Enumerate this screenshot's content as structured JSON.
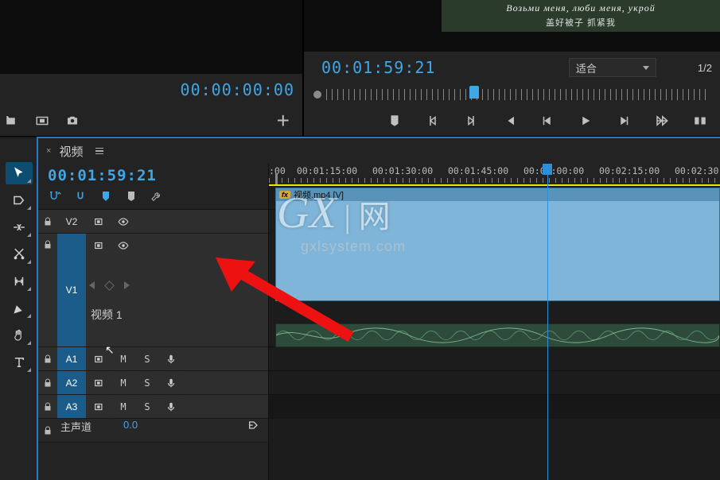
{
  "source_monitor": {
    "timecode": "00:00:00:00"
  },
  "program_monitor": {
    "timecode": "00:01:59:21",
    "fit_label": "适合",
    "page_indicator": "1/2",
    "subtitle_line1": "Возьми меня, люби меня, укрой",
    "subtitle_line2": "盖好被子 抓紧我"
  },
  "sequence": {
    "name": "视频",
    "playhead_timecode": "00:01:59:21",
    "time_labels": [
      ":00",
      "00:01:15:00",
      "00:01:30:00",
      "00:01:45:00",
      "00:02:00:00",
      "00:02:15:00",
      "00:02:30:"
    ],
    "tracks": {
      "v2": {
        "label": "V2"
      },
      "v1": {
        "label": "V1",
        "name": "视频 1"
      },
      "a1": {
        "label": "A1",
        "mute": "M",
        "solo": "S"
      },
      "a2": {
        "label": "A2",
        "mute": "M",
        "solo": "S"
      },
      "a3": {
        "label": "A3",
        "mute": "M",
        "solo": "S"
      },
      "master": {
        "label": "主声道",
        "value": "0.0"
      }
    },
    "clip": {
      "name": "视频.mp4 [V]",
      "fx_badge": "fx"
    }
  },
  "icons": {
    "plus": "+"
  }
}
